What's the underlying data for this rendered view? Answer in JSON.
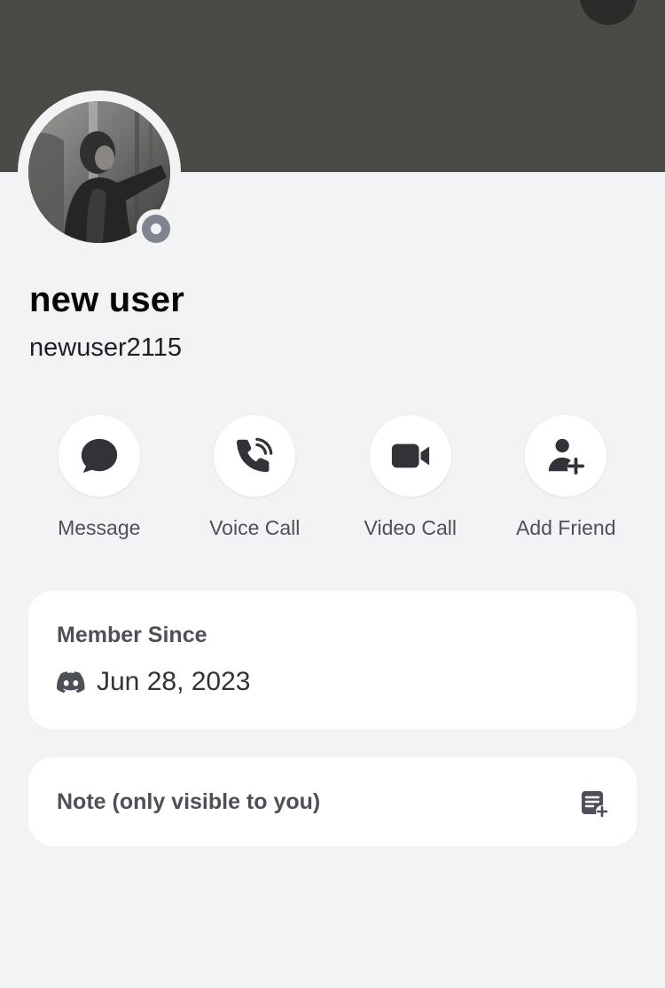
{
  "profile": {
    "display_name": "new user",
    "username": "newuser2115",
    "status": "offline",
    "avatar": "profile-photo",
    "banner_color": "#4a4a47"
  },
  "actions": [
    {
      "label": "Message",
      "icon": "chat-bubble-icon"
    },
    {
      "label": "Voice Call",
      "icon": "phone-call-icon"
    },
    {
      "label": "Video Call",
      "icon": "video-camera-icon"
    },
    {
      "label": "Add Friend",
      "icon": "add-friend-icon"
    }
  ],
  "member_since": {
    "title": "Member Since",
    "icon": "discord-logo-icon",
    "date": "Jun 28, 2023"
  },
  "note": {
    "title": "Note (only visible to you)",
    "icon": "add-note-icon"
  },
  "colors": {
    "background": "#f2f3f5",
    "card": "#ffffff",
    "icon": "#313338",
    "muted_text": "#4e5058",
    "status_offline": "#80848e"
  }
}
